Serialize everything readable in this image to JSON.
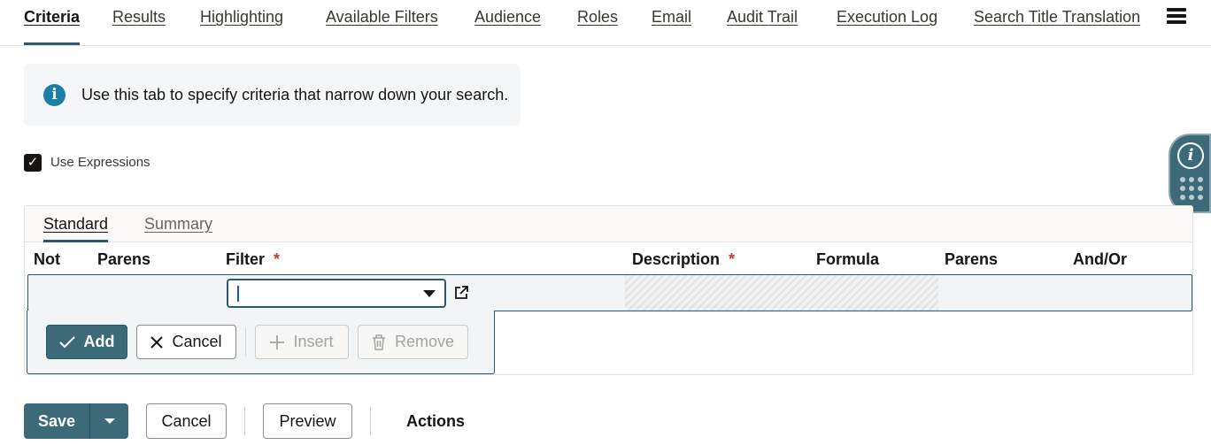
{
  "top_tabs": [
    {
      "label": "Criteria"
    },
    {
      "label": "Results"
    },
    {
      "label": "Highlighting"
    },
    {
      "label": "Available Filters"
    },
    {
      "label": "Audience"
    },
    {
      "label": "Roles"
    },
    {
      "label": "Email"
    },
    {
      "label": "Audit Trail"
    },
    {
      "label": "Execution Log"
    },
    {
      "label": "Search Title Translation"
    }
  ],
  "menu_icon": "hamburger-menu-icon",
  "info_banner": {
    "icon": "info-icon",
    "text": "Use this tab to specify criteria that narrow down your search."
  },
  "use_expressions": {
    "label": "Use Expressions",
    "checked": true
  },
  "side_widget": {
    "info_symbol": "i",
    "dots_icon": "app-grid-icon"
  },
  "criteria": {
    "subtabs": [
      {
        "label": "Standard"
      },
      {
        "label": "Summary"
      }
    ],
    "columns": {
      "not": "Not",
      "parens_open": "Parens",
      "filter": "Filter",
      "description": "Description",
      "formula": "Formula",
      "parens_close": "Parens",
      "and_or": "And/Or"
    },
    "required_mark": "*",
    "filter_value": "",
    "buttons": {
      "add": "Add",
      "cancel": "Cancel",
      "insert": "Insert",
      "remove": "Remove"
    }
  },
  "toolbar": {
    "save": "Save",
    "cancel": "Cancel",
    "preview": "Preview",
    "actions": "Actions"
  },
  "colors": {
    "accent": "#3c6a78",
    "active_tab_underline": "#2c5967",
    "required": "#b6432e",
    "info": "#1b7fa6"
  }
}
